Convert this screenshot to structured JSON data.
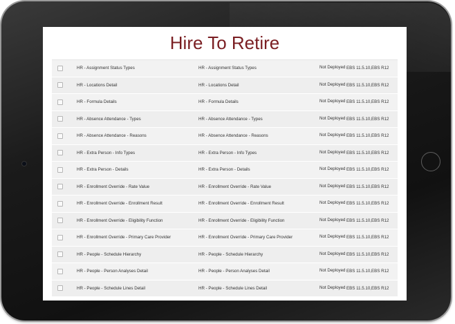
{
  "page": {
    "title": "Hire To Retire"
  },
  "rows": [
    {
      "name": "HR - Assignment Status Types",
      "description": "HR - Assignment Status Types",
      "status": "Not Deployed",
      "version": "EBS 11.5.10,EBS R12"
    },
    {
      "name": "HR - Locations Detail",
      "description": "HR - Locations Detail",
      "status": "Not Deployed",
      "version": "EBS 11.5.10,EBS R12"
    },
    {
      "name": "HR - Formula Details",
      "description": "HR - Formula Details",
      "status": "Not Deployed",
      "version": "EBS 11.5.10,EBS R12"
    },
    {
      "name": "HR - Absence Attendance - Types",
      "description": "HR - Absence Attendance - Types",
      "status": "Not Deployed",
      "version": "EBS 11.5.10,EBS R12"
    },
    {
      "name": "HR - Absence Attendance - Reasons",
      "description": "HR - Absence Attendance - Reasons",
      "status": "Not Deployed",
      "version": "EBS 11.5.10,EBS R12"
    },
    {
      "name": "HR - Extra Person - Info Types",
      "description": "HR - Extra Person - Info Types",
      "status": "Not Deployed",
      "version": "EBS 11.5.10,EBS R12"
    },
    {
      "name": "HR - Extra Person - Details",
      "description": "HR - Extra Person - Details",
      "status": "Not Deployed",
      "version": "EBS 11.5.10,EBS R12"
    },
    {
      "name": "HR - Enrollment Override - Rate Value",
      "description": "HR - Enrollment Override - Rate Value",
      "status": "Not Deployed",
      "version": "EBS 11.5.10,EBS R12"
    },
    {
      "name": "HR - Enrollment Override - Enrollment Result",
      "description": "HR - Enrollment Override - Enrollment Result",
      "status": "Not Deployed",
      "version": "EBS 11.5.10,EBS R12"
    },
    {
      "name": "HR - Enrollment Override - Eligibility Function",
      "description": "HR - Enrollment Override - Eligibility Function",
      "status": "Not Deployed",
      "version": "EBS 11.5.10,EBS R12"
    },
    {
      "name": "HR - Enrollment Override - Primary Care Provider",
      "description": "HR - Enrollment Override - Primary Care Provider",
      "status": "Not Deployed",
      "version": "EBS 11.5.10,EBS R12"
    },
    {
      "name": "HR - People - Schedule Hierarchy",
      "description": "HR - People - Schedule Hierarchy",
      "status": "Not Deployed",
      "version": "EBS 11.5.10,EBS R12"
    },
    {
      "name": "HR - People - Person Analyses Detail",
      "description": "HR - People - Person Analyses Detail",
      "status": "Not Deployed",
      "version": "EBS 11.5.10,EBS R12"
    },
    {
      "name": "HR - People - Schedule Lines Detail",
      "description": "HR - People - Schedule Lines Detail",
      "status": "Not Deployed",
      "version": "EBS 11.5.10,EBS R12"
    }
  ],
  "colors": {
    "title": "#7a1e22",
    "row_bg": "#f2f2f2",
    "bezel": "#1b1b1b"
  }
}
